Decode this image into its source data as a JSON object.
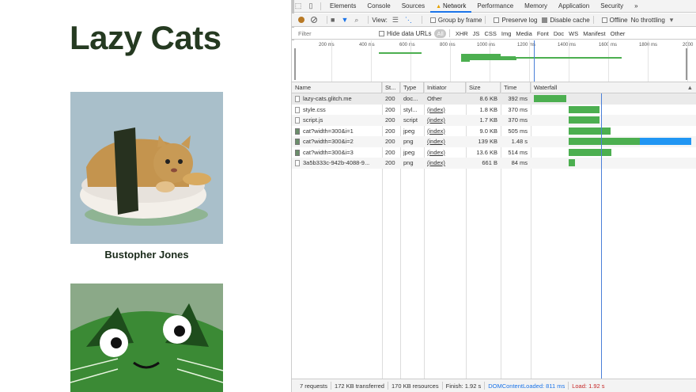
{
  "page": {
    "title": "Lazy Cats",
    "cats": [
      {
        "name": "Bustopher Jones"
      }
    ]
  },
  "devtools": {
    "tabs": [
      "Elements",
      "Console",
      "Sources",
      "Network",
      "Performance",
      "Memory",
      "Application",
      "Security"
    ],
    "active_tab": "Network",
    "more": "»",
    "toolbar": {
      "view_label": "View:",
      "group_by_frame": "Group by frame",
      "preserve_log": "Preserve log",
      "disable_cache": "Disable cache",
      "offline": "Offline",
      "throttling": "No throttling"
    },
    "filter": {
      "placeholder": "Filter",
      "hide_data_urls": "Hide data URLs",
      "types": [
        "All",
        "XHR",
        "JS",
        "CSS",
        "Img",
        "Media",
        "Font",
        "Doc",
        "WS",
        "Manifest",
        "Other"
      ]
    },
    "overview_ticks": [
      "200 ms",
      "400 ms",
      "600 ms",
      "800 ms",
      "1000 ms",
      "1200 ms",
      "1400 ms",
      "1600 ms",
      "1800 ms",
      "2000"
    ],
    "columns": [
      "Name",
      "St...",
      "Type",
      "Initiator",
      "Size",
      "Time",
      "Waterfall"
    ],
    "requests": [
      {
        "name": "lazy-cats.glitch.me",
        "status": "200",
        "type": "doc...",
        "initiator": "Other",
        "size": "8.6 KB",
        "time": "392 ms",
        "start": 0,
        "wait": 392,
        "recv": 0,
        "icon": "doc"
      },
      {
        "name": "style.css",
        "status": "200",
        "type": "styl...",
        "initiator": "(index)",
        "size": "1.8 KB",
        "time": "370 ms",
        "start": 415,
        "wait": 370,
        "recv": 0,
        "icon": "doc"
      },
      {
        "name": "script.js",
        "status": "200",
        "type": "script",
        "initiator": "(index)",
        "size": "1.7 KB",
        "time": "370 ms",
        "start": 415,
        "wait": 370,
        "recv": 0,
        "icon": "doc"
      },
      {
        "name": "cat?width=300&i=1",
        "status": "200",
        "type": "jpeg",
        "initiator": "(index)",
        "size": "9.0 KB",
        "time": "505 ms",
        "start": 415,
        "wait": 505,
        "recv": 0,
        "icon": "img"
      },
      {
        "name": "cat?width=300&i=2",
        "status": "200",
        "type": "png",
        "initiator": "(index)",
        "size": "139 KB",
        "time": "1.48 s",
        "start": 415,
        "wait": 860,
        "recv": 620,
        "icon": "img"
      },
      {
        "name": "cat?width=300&i=3",
        "status": "200",
        "type": "jpeg",
        "initiator": "(index)",
        "size": "13.6 KB",
        "time": "514 ms",
        "start": 415,
        "wait": 514,
        "recv": 0,
        "icon": "img"
      },
      {
        "name": "3a5b333c-942b-4088-9...",
        "status": "200",
        "type": "png",
        "initiator": "(index)",
        "size": "661 B",
        "time": "84 ms",
        "start": 415,
        "wait": 84,
        "recv": 0,
        "icon": "doc"
      }
    ],
    "dom_content_loaded_ms": 811,
    "waterfall_max_ms": 1920,
    "status": {
      "requests": "7 requests",
      "transferred": "172 KB transferred",
      "resources": "170 KB resources",
      "finish": "Finish: 1.92 s",
      "dcl": "DOMContentLoaded: 811 ms",
      "load": "Load: 1.92 s"
    },
    "colors": {
      "accent": "#1a73e8",
      "bar_wait": "#4caf50",
      "bar_recv": "#2196f3",
      "dcl_line": "#4a7fd8"
    }
  }
}
